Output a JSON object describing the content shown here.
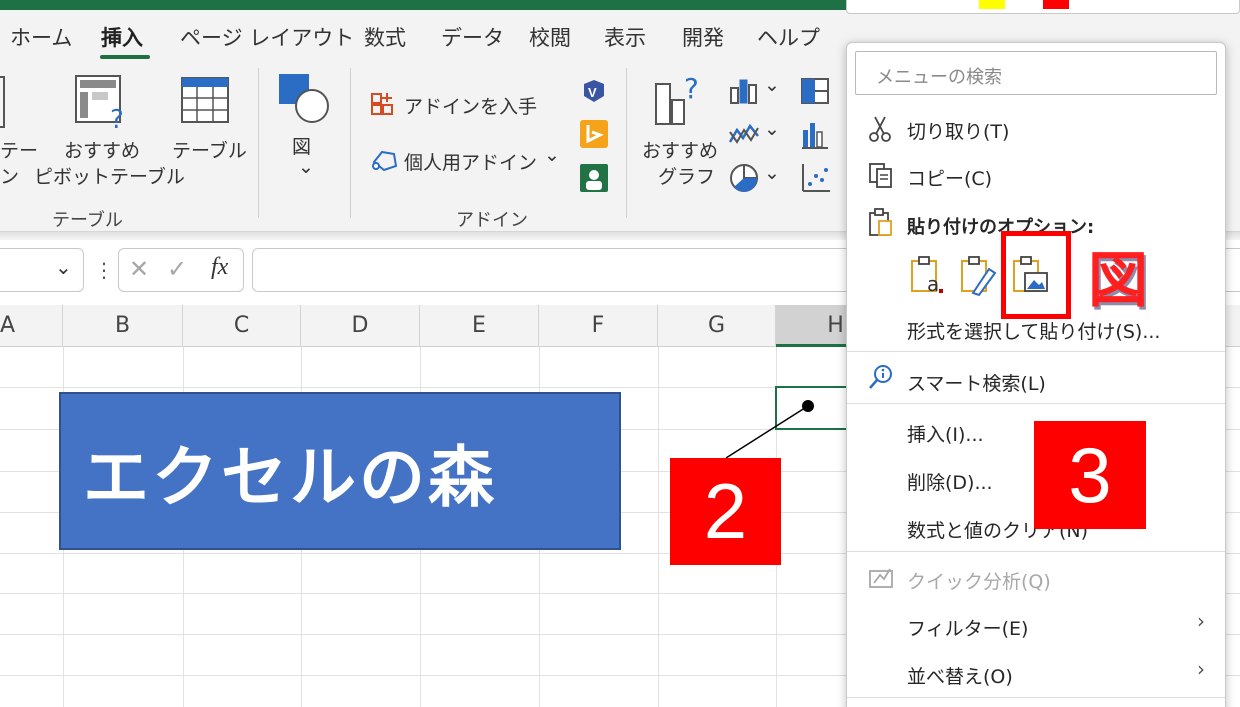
{
  "ribbon_tabs": [
    {
      "label": "ホーム",
      "active": false
    },
    {
      "label": "挿入",
      "active": true
    },
    {
      "label": "ページ レイアウト",
      "active": false
    },
    {
      "label": "数式",
      "active": false
    },
    {
      "label": "データ",
      "active": false
    },
    {
      "label": "校閲",
      "active": false
    },
    {
      "label": "表示",
      "active": false
    },
    {
      "label": "開発",
      "active": false
    },
    {
      "label": "ヘルプ",
      "active": false
    }
  ],
  "ribbon": {
    "pivot_partial_top": "テー",
    "pivot_partial_bottom": "ン",
    "recommended_pivot_line1": "おすすめ",
    "recommended_pivot_line2": "ピボットテーブル",
    "table": "テーブル",
    "group_table": "テーブル",
    "illustrations": "図",
    "get_addins": "アドインを入手",
    "my_addins": "個人用アドイン",
    "group_addins": "アドイン",
    "recommended_charts_line1": "おすすめ",
    "recommended_charts_line2": "グラフ",
    "dropdown_glyph": "⌄"
  },
  "formula_bar": {
    "fx_label": "fx",
    "cancel_glyph": "✕",
    "enter_glyph": "✓",
    "more_glyph": "⋮"
  },
  "columns": [
    "A",
    "B",
    "C",
    "D",
    "E",
    "F",
    "G",
    "H"
  ],
  "shape_text": "エクセルの森",
  "callouts": {
    "step2": "2",
    "step3": "3"
  },
  "zu_label": "図",
  "context_menu": {
    "search_placeholder": "メニューの検索",
    "cut": "切り取り(T)",
    "copy": "コピー(C)",
    "paste_options": "貼り付けのオプション:",
    "paste_special": "形式を選択して貼り付け(S)...",
    "smart_lookup": "スマート検索(L)",
    "insert": "挿入(I)...",
    "delete": "削除(D)...",
    "clear_contents": "数式と値のクリア(N)",
    "quick_analysis": "クイック分析(Q)",
    "filter": "フィルター(E)",
    "sort": "並べ替え(O)",
    "submenu_chevron": "›"
  },
  "colors": {
    "accent_green": "#1e7145",
    "shape_blue": "#4472c4",
    "callout_red": "#ff0000"
  }
}
